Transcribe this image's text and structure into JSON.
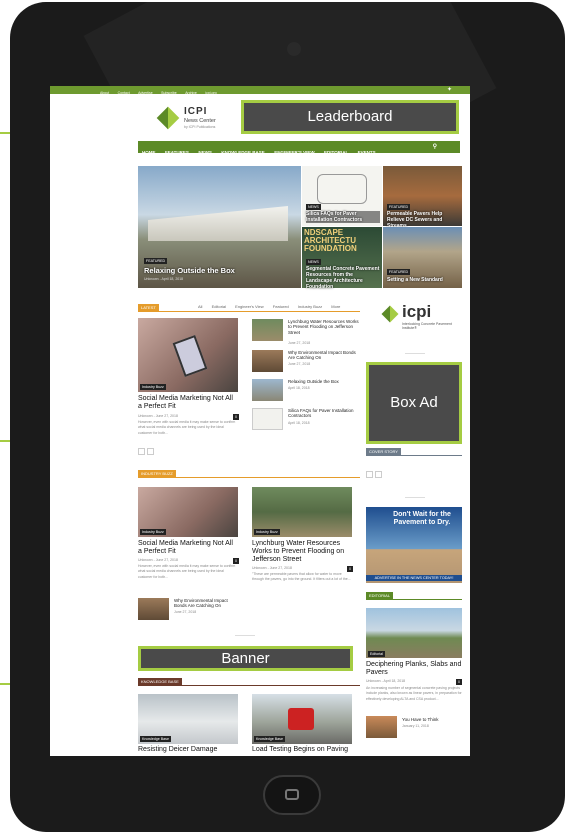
{
  "topbar": {
    "links": [
      "About",
      "Contact",
      "Advertise",
      "Subscribe",
      "Archive",
      "icpi.org"
    ],
    "social_icon": "twitter-icon"
  },
  "logo": {
    "name": "ICPI",
    "subtitle": "News Center",
    "sub2": "by ICPI Publications"
  },
  "leaderboard": "Leaderboard",
  "nav": {
    "items": [
      "HOME",
      "FEATURES",
      "NEWS",
      "KNOWLEDGE BASE",
      "ENGINEER'S VIEW",
      "EDITORIAL",
      "EVENTS"
    ],
    "search_icon": "search-icon"
  },
  "hero": {
    "main": {
      "tag": "FEATURED",
      "title": "Relaxing Outside the Box",
      "meta": "Unknown - April 18, 2018"
    },
    "tiles": [
      {
        "tag": "NEWS",
        "title": "Silica FAQs for Paver Installation Contractors"
      },
      {
        "tag": "FEATURED",
        "title": "Permeable Pavers Help Relieve DC Sewers and Streams"
      },
      {
        "tag": "NEWS",
        "title": "Segmental Concrete Pavement Resources from the Landscape Architecture Foundation",
        "banner": "NDSCAPE ARCHITECTU FOUNDATION"
      },
      {
        "tag": "FEATURED",
        "title": "Setting a New Standard"
      }
    ]
  },
  "latest": {
    "label": "LATEST",
    "tabs": [
      "All",
      "Editorial",
      "Engineer's View",
      "Featured",
      "Industry Buzz",
      "More"
    ],
    "main": {
      "tag": "Industry Buzz",
      "title": "Social Media Marketing Not All a Perfect Fit",
      "meta": "Unknown - June 27, 2018",
      "count": "0",
      "excerpt": "However, even with social media it may make sense to confirm what social media channels are being used by the ideal customer for both..."
    },
    "list": [
      {
        "title": "Lynchburg Water Resources Works to Prevent Flooding on Jefferson Street",
        "meta": "June 27, 2018"
      },
      {
        "title": "Why Environmental Impact Bonds Are Catching On",
        "meta": "June 27, 2018"
      },
      {
        "title": "Relaxing Outside the Box",
        "meta": "April 18, 2018"
      },
      {
        "title": "Silica FAQs for Paver Installation Contractors",
        "meta": "April 18, 2018"
      }
    ]
  },
  "buzz": {
    "label": "INDUSTRY BUZZ",
    "left": {
      "tag": "Industry Buzz",
      "title": "Social Media Marketing Not All a Perfect Fit",
      "meta": "Unknown - June 27, 2018",
      "count": "0",
      "excerpt": "However, even with social media it may make sense to confirm what social media channels are being used by the ideal customer for both..."
    },
    "right": {
      "tag": "Industry Buzz",
      "title": "Lynchburg Water Resources Works to Prevent Flooding on Jefferson Street",
      "meta": "Unknown - June 27, 2018",
      "count": "0",
      "excerpt": "\"These are permeable pavers that allow for water to move through the pavers, go into the ground. It filters out a lot of the..."
    },
    "small": {
      "title": "Why Environmental Impact Bonds Are Catching On",
      "meta": "June 27, 2018"
    }
  },
  "banner": "Banner",
  "kb": {
    "label": "KNOWLEDGE BASE",
    "items": [
      {
        "tag": "Knowledge Base",
        "title": "Resisting Deicer Damage"
      },
      {
        "tag": "Knowledge Base",
        "title": "Load Testing Begins on Paving"
      }
    ]
  },
  "sidebar": {
    "icpi_logo": "icpi",
    "icpi_sub": "Interlocking Concrete Pavement Institute®",
    "box_ad": "Box Ad",
    "cover_story": "COVER STORY",
    "ad_title": "Don't Wait for the Pavement to Dry.",
    "ad_footer": "ADVERTISE IN THE NEWS CENTER TODAY!",
    "editorial": "EDITORIAL",
    "ed_tag": "Editorial",
    "ed_title": "Deciphering Planks, Slabs and Pavers",
    "ed_meta": "Unknown - April 18, 2018",
    "ed_count": "0",
    "ed_excerpt": "An increasing number of segmental concrete paving projects include planks, also known as linear pavers, in preparation for effectively developing ALTA and CSA product...",
    "small_title": "You Have to Think",
    "small_meta": "January 11, 2018"
  },
  "colors": {
    "green": "#6e9a2f",
    "accent": "#a5cc43",
    "orange": "#e59c2b",
    "ad_grey": "#4a4a4a"
  }
}
